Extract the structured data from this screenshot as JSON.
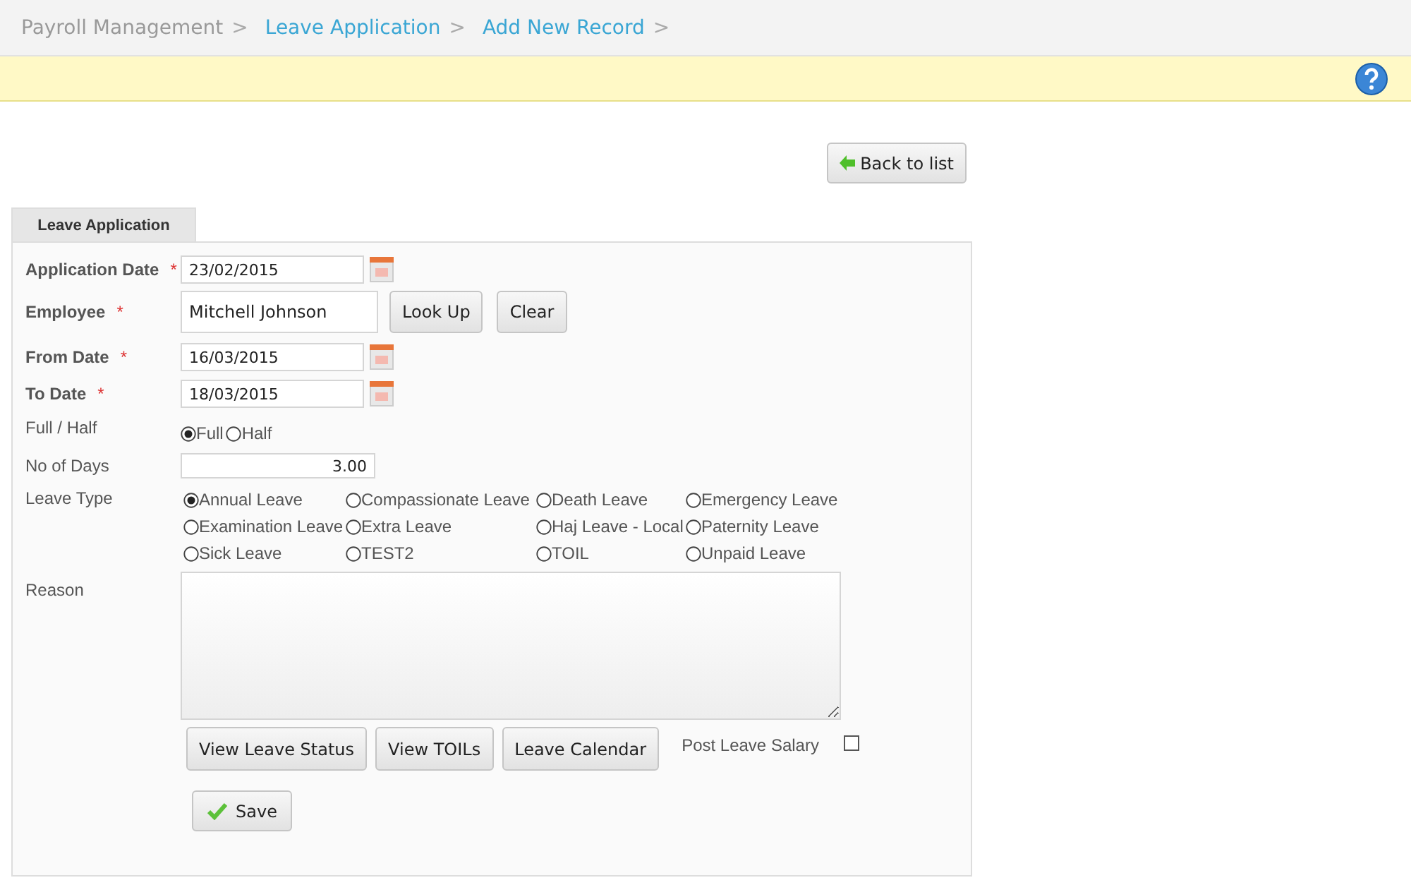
{
  "breadcrumb": [
    {
      "label": "Payroll Management",
      "kind": "plain",
      "separator": ">"
    },
    {
      "label": "Leave Application",
      "kind": "link",
      "separator": ">"
    },
    {
      "label": "Add New Record",
      "kind": "link",
      "separator": ">"
    }
  ],
  "back_button": "Back to list",
  "tabs": [
    {
      "label": "Leave Application",
      "selected": true
    }
  ],
  "fields": [
    {
      "label": "Application Date",
      "required_mark": "*",
      "value": "23/02/2015",
      "kind": "date"
    },
    {
      "label": "Employee",
      "required_mark": "*",
      "value": "Mitchell Johnson",
      "kind": "lookup",
      "buttons": [
        "Look Up",
        "Clear"
      ]
    },
    {
      "label": "From Date",
      "required_mark": "*",
      "value": "16/03/2015",
      "kind": "date"
    },
    {
      "label": "To Date",
      "required_mark": "*",
      "value": "18/03/2015",
      "kind": "date"
    }
  ],
  "full_half": {
    "label": "Full / Half",
    "options": [
      {
        "label": "Full",
        "selected": true
      },
      {
        "label": "Half",
        "selected": false
      }
    ]
  },
  "no_of_days": {
    "label": "No of Days",
    "value": "3.00"
  },
  "leave_type": {
    "label": "Leave Type",
    "options": [
      {
        "label": "Annual Leave",
        "selected": true
      },
      {
        "label": "Compassionate Leave",
        "selected": false
      },
      {
        "label": "Death Leave",
        "selected": false
      },
      {
        "label": "Emergency Leave",
        "selected": false
      },
      {
        "label": "Examination Leave",
        "selected": false
      },
      {
        "label": "Extra Leave",
        "selected": false
      },
      {
        "label": "Haj Leave - Local",
        "selected": false
      },
      {
        "label": "Paternity Leave",
        "selected": false
      },
      {
        "label": "Sick Leave",
        "selected": false
      },
      {
        "label": "TEST2",
        "selected": false
      },
      {
        "label": "TOIL",
        "selected": false
      },
      {
        "label": "Unpaid Leave",
        "selected": false
      }
    ]
  },
  "reason": {
    "label": "Reason"
  },
  "action_buttons": [
    "View Leave Status",
    "View TOILs",
    "Leave Calendar"
  ],
  "post_leave_salary": {
    "label": "Post Leave Salary",
    "checked": false
  },
  "save_button": "Save"
}
